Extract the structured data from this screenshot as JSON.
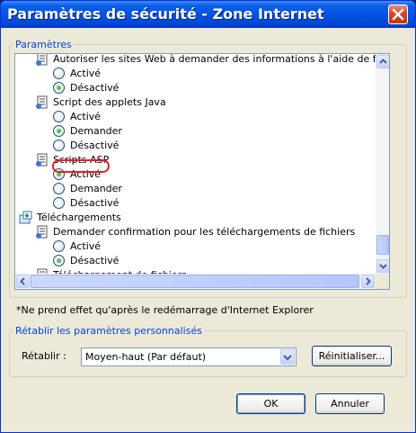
{
  "window": {
    "title": "Paramètres de sécurité - Zone Internet"
  },
  "settings_group": {
    "legend": "Paramètres"
  },
  "tree": {
    "items": [
      {
        "kind": "setting",
        "label": "Autoriser les sites Web à demander des informations à l'aide de fenêtre"
      },
      {
        "kind": "radio",
        "label": "Activé",
        "checked": false
      },
      {
        "kind": "radio",
        "label": "Désactivé",
        "checked": true
      },
      {
        "kind": "setting",
        "label": "Script des applets Java"
      },
      {
        "kind": "radio",
        "label": "Activé",
        "checked": false
      },
      {
        "kind": "radio",
        "label": "Demander",
        "checked": true
      },
      {
        "kind": "radio",
        "label": "Désactivé",
        "checked": false
      },
      {
        "kind": "setting",
        "label": "Scripts ASP",
        "highlighted": true
      },
      {
        "kind": "radio",
        "label": "Activé",
        "checked": true
      },
      {
        "kind": "radio",
        "label": "Demander",
        "checked": false
      },
      {
        "kind": "radio",
        "label": "Désactivé",
        "checked": false
      },
      {
        "kind": "category",
        "label": "Téléchargements"
      },
      {
        "kind": "setting",
        "label": "Demander confirmation pour les téléchargements de fichiers"
      },
      {
        "kind": "radio",
        "label": "Activé",
        "checked": false
      },
      {
        "kind": "radio",
        "label": "Désactivé",
        "checked": true
      },
      {
        "kind": "setting",
        "label": "Téléchargement de fichiers"
      }
    ]
  },
  "note": "*Ne prend effet qu'après le redémarrage d'Internet Explorer",
  "reset_group": {
    "legend": "Rétablir les paramètres personnalisés",
    "label": "Rétablir :",
    "selected": "Moyen-haut (Par défaut)",
    "reset_button": "Réinitialiser..."
  },
  "buttons": {
    "ok": "OK",
    "cancel": "Annuler"
  },
  "colors": {
    "titlebar": "#0054E3",
    "highlight_ring": "#E0202A",
    "legend_text": "#0046D5"
  }
}
